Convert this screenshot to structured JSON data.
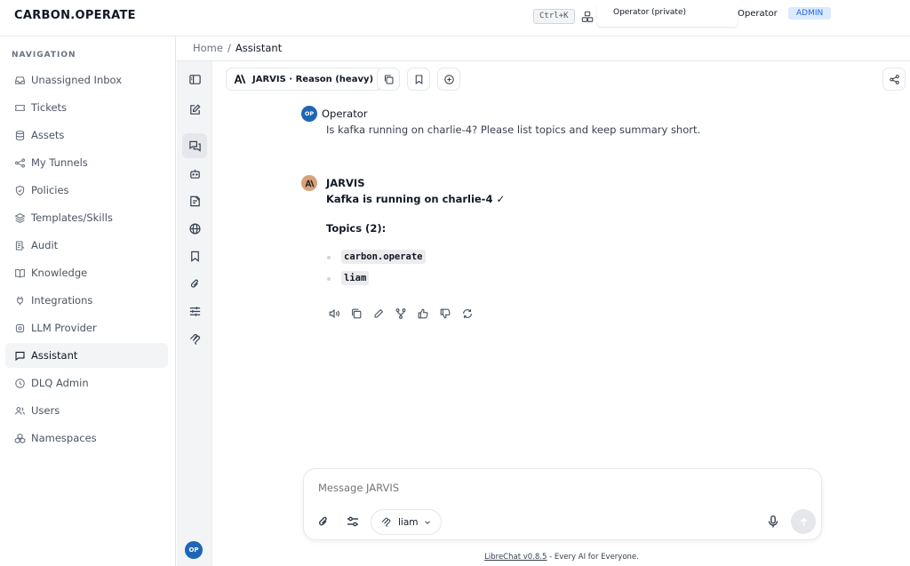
{
  "app": {
    "brand": "CARBON.OPERATE"
  },
  "topbar": {
    "shortcut": "Ctrl+K",
    "tenant_select": "Operator (private)",
    "user": "Operator",
    "role_badge": "ADMIN",
    "accent_color": "#2563eb"
  },
  "sidebar": {
    "heading": "NAVIGATION",
    "items": [
      {
        "label": "Unassigned Inbox",
        "icon": "inbox-icon"
      },
      {
        "label": "Tickets",
        "icon": "ticket-icon"
      },
      {
        "label": "Assets",
        "icon": "database-icon"
      },
      {
        "label": "My Tunnels",
        "icon": "network-icon"
      },
      {
        "label": "Policies",
        "icon": "shield-icon"
      },
      {
        "label": "Templates/Skills",
        "icon": "layers-icon"
      },
      {
        "label": "Audit",
        "icon": "audit-icon"
      },
      {
        "label": "Knowledge",
        "icon": "book-icon"
      },
      {
        "label": "Integrations",
        "icon": "plug-icon"
      },
      {
        "label": "LLM Provider",
        "icon": "cog-icon"
      },
      {
        "label": "Assistant",
        "icon": "chat-icon",
        "active": true
      },
      {
        "label": "DLQ Admin",
        "icon": "clock-icon"
      },
      {
        "label": "Users",
        "icon": "users-icon"
      },
      {
        "label": "Namespaces",
        "icon": "boxes-icon"
      }
    ]
  },
  "breadcrumb": {
    "home": "Home",
    "separator": "/",
    "current": "Assistant"
  },
  "rail": {
    "avatar_initials": "OP"
  },
  "chat": {
    "model_label": "JARVIS · Reason (heavy)",
    "messages": {
      "user": {
        "avatar": "OP",
        "author": "Operator",
        "text": "Is kafka running on charlie-4? Please list topics and keep summary short."
      },
      "assistant": {
        "author": "JARVIS",
        "headline": "Kafka is running on charlie-4 ✓",
        "topics_heading": "Topics (2):",
        "topics": [
          "carbon.operate",
          "liam"
        ]
      }
    }
  },
  "composer": {
    "placeholder": "Message JARVIS",
    "mcp_server": "liam"
  },
  "footer": {
    "link": "LibreChat v0.8.5",
    "tagline": " - Every AI for Everyone."
  }
}
